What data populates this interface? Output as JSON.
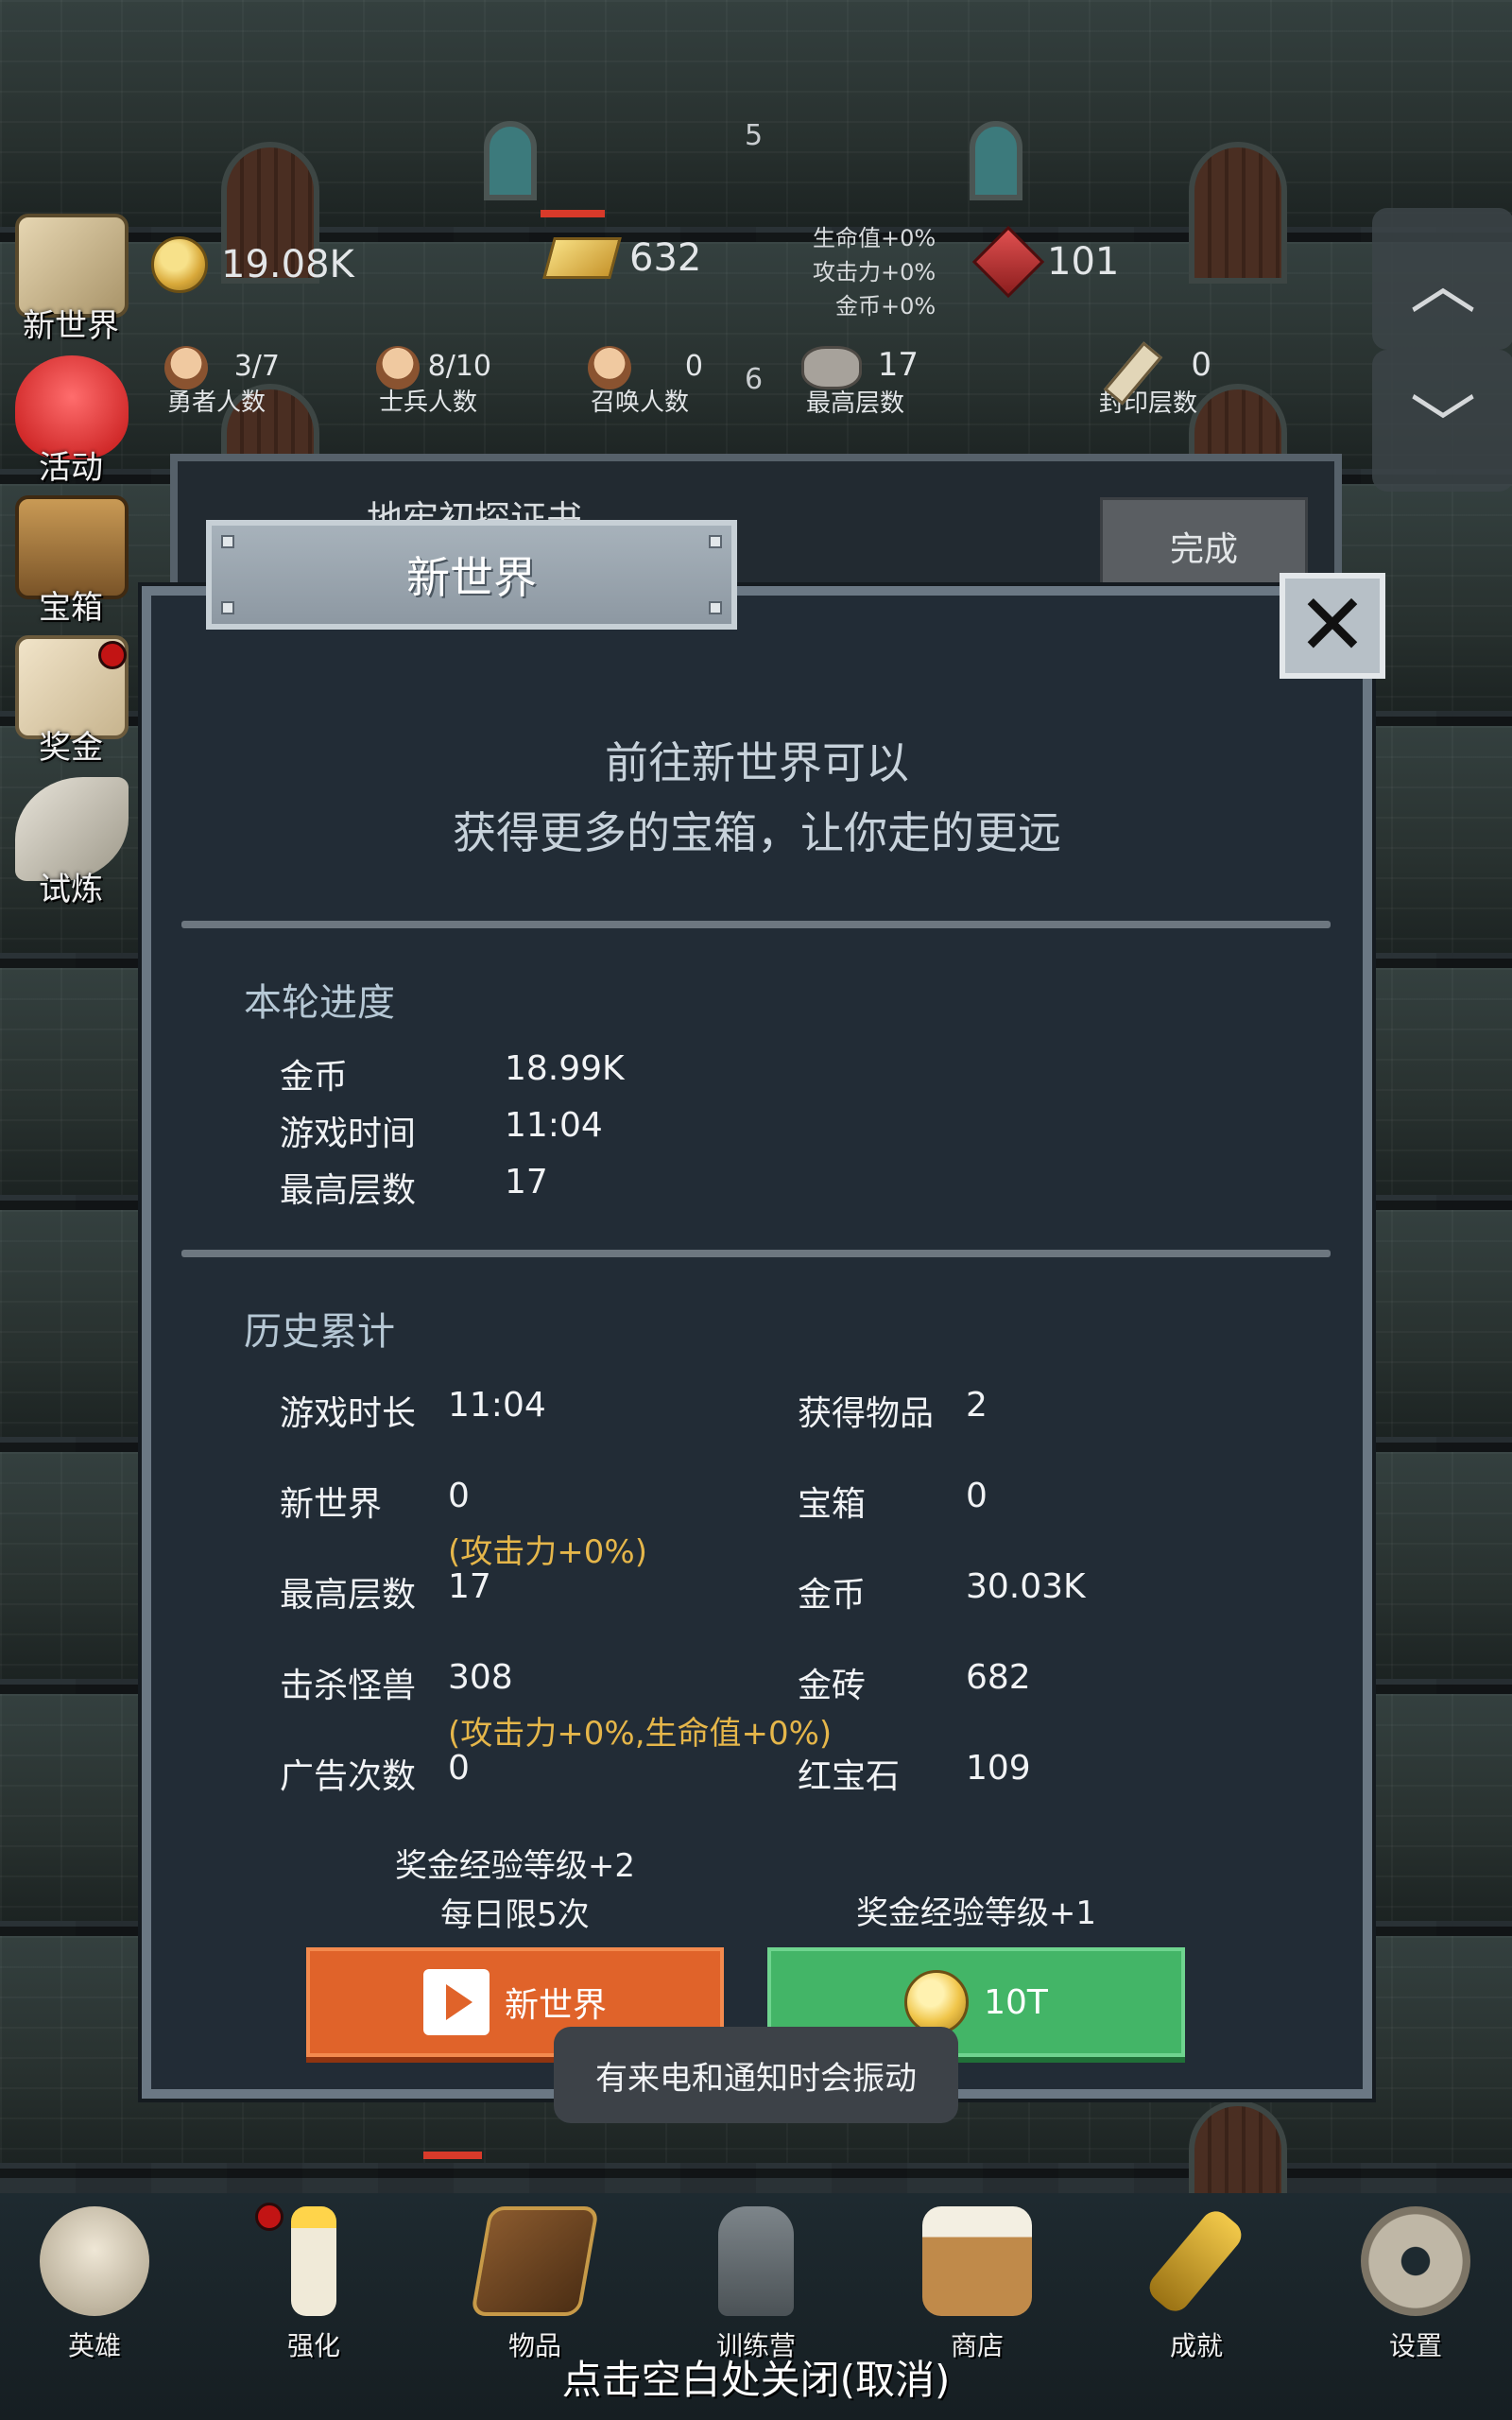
{
  "hud": {
    "gold": "19.08K",
    "gold_bars": "632",
    "buffs": [
      "生命值+0%",
      "攻击力+0%",
      "金币+0%"
    ],
    "rubies": "101",
    "heroes": {
      "count": "3/7",
      "label": "勇者人数"
    },
    "soldiers": {
      "count": "8/10",
      "label": "士兵人数"
    },
    "summons": {
      "count": "0",
      "label": "召唤人数"
    },
    "max_floor": {
      "count": "17",
      "label": "最高层数"
    },
    "sealed_floor": {
      "count": "0",
      "label": "封印层数"
    },
    "floor_marker_top": "5",
    "floor_marker_mid": "6"
  },
  "side_menu": [
    {
      "label": "新世界",
      "icon": "map-icon"
    },
    {
      "label": "活动",
      "icon": "heart-icon"
    },
    {
      "label": "宝箱",
      "icon": "chest-icon"
    },
    {
      "label": "奖金",
      "icon": "envelope-icon"
    },
    {
      "label": "试炼",
      "icon": "feather-icon"
    }
  ],
  "quest": {
    "title": "地牢初探证书",
    "button": "完成"
  },
  "modal": {
    "title": "新世界",
    "intro_line1": "前往新世界可以",
    "intro_line2": "获得更多的宝箱，让你走的更远",
    "current": {
      "title": "本轮进度",
      "rows": [
        {
          "label": "金币",
          "value": "18.99K"
        },
        {
          "label": "游戏时间",
          "value": "11:04"
        },
        {
          "label": "最高层数",
          "value": "17"
        }
      ]
    },
    "history": {
      "title": "历史累计",
      "left": [
        {
          "label": "游戏时长",
          "value": "11:04"
        },
        {
          "label": "新世界",
          "value": "0"
        },
        {
          "label": "最高层数",
          "value": "17"
        },
        {
          "label": "击杀怪兽",
          "value": "308"
        },
        {
          "label": "广告次数",
          "value": "0"
        }
      ],
      "right": [
        {
          "label": "获得物品",
          "value": "2"
        },
        {
          "label": "宝箱",
          "value": "0"
        },
        {
          "label": "金币",
          "value": "30.03K"
        },
        {
          "label": "金砖",
          "value": "682"
        },
        {
          "label": "红宝石",
          "value": "109"
        }
      ],
      "bonus_new_world": "(攻击力+0%)",
      "bonus_kills": "(攻击力+0%,生命值+0%)"
    },
    "ad_option": {
      "caption_line1": "奖金经验等级+2",
      "caption_line2": "每日限5次",
      "button": "新世界"
    },
    "pay_option": {
      "caption": "奖金经验等级+1",
      "button": "10T"
    }
  },
  "toast": "有来电和通知时会振动",
  "bottom_nav": [
    {
      "label": "英雄",
      "icon": "skull-icon"
    },
    {
      "label": "强化",
      "icon": "candle-icon"
    },
    {
      "label": "物品",
      "icon": "book-icon"
    },
    {
      "label": "训练营",
      "icon": "lantern-icon"
    },
    {
      "label": "商店",
      "icon": "mug-icon"
    },
    {
      "label": "成就",
      "icon": "key-icon"
    },
    {
      "label": "设置",
      "icon": "gear-icon"
    }
  ],
  "footer_hint": "点击空白处关闭(取消)",
  "colors": {
    "modal_bg": "#222c36",
    "bonus_text": "#e5b64a",
    "ad_button": "#e0632a",
    "pay_button": "#43b567",
    "notification_dot": "#c21414"
  }
}
